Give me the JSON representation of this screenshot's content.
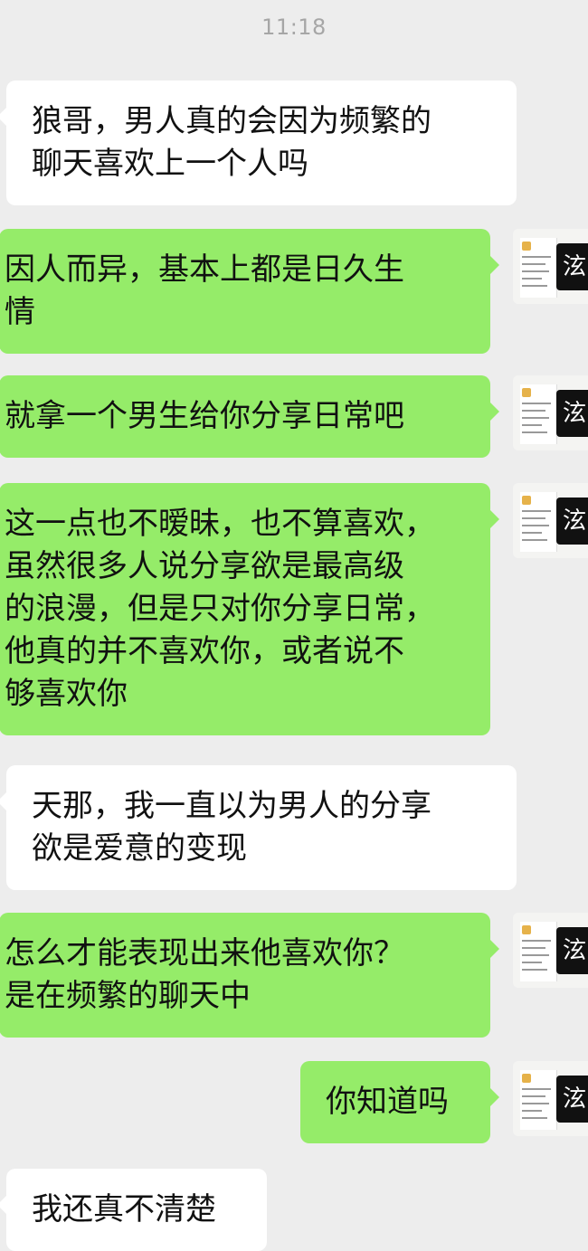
{
  "status": {
    "time": "11:18"
  },
  "messages": [
    {
      "side": "in",
      "lines": [
        "狼哥，男人真的会因为频繁的",
        "聊天喜欢上一个人吗"
      ]
    },
    {
      "side": "out",
      "lines": [
        "因人而异，基本上都是日久生",
        "情"
      ]
    },
    {
      "side": "out",
      "lines": [
        "就拿一个男生给你分享日常吧"
      ]
    },
    {
      "side": "out",
      "lines": [
        "这一点也不暧昧，也不算喜欢，",
        "虽然很多人说分享欲是最高级",
        "的浪漫，但是只对你分享日常，",
        "他真的并不喜欢你，或者说不",
        "够喜欢你"
      ]
    },
    {
      "side": "in",
      "lines": [
        "天那，我一直以为男人的分享",
        "欲是爱意的变现"
      ]
    },
    {
      "side": "out",
      "lines": [
        "怎么才能表现出来他喜欢你？",
        "是在频繁的聊天中"
      ]
    },
    {
      "side": "out",
      "lines": [
        "你知道吗"
      ]
    },
    {
      "side": "in",
      "lines": [
        "我还真不清楚"
      ]
    }
  ],
  "avatar": {
    "icon": "calligraphy-avatar-icon",
    "glyph": "泫"
  },
  "colors": {
    "background": "#ededed",
    "outgoing_bubble": "#95ec69",
    "incoming_bubble": "#ffffff"
  }
}
